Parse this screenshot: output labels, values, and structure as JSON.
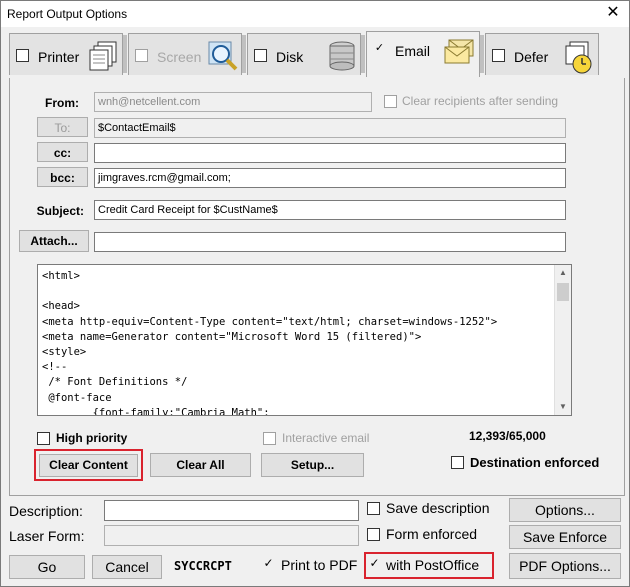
{
  "window": {
    "title": "Report Output Options",
    "close_glyph": "✕"
  },
  "tabs": [
    {
      "label": "Printer",
      "checked": false,
      "disabled": false,
      "icon": "printer-icon"
    },
    {
      "label": "Screen",
      "checked": false,
      "disabled": true,
      "icon": "magnifier-icon"
    },
    {
      "label": "Disk",
      "checked": false,
      "disabled": false,
      "icon": "disk-icon"
    },
    {
      "label": "Email",
      "checked": true,
      "disabled": false,
      "icon": "envelope-icon"
    },
    {
      "label": "Defer",
      "checked": false,
      "disabled": false,
      "icon": "clock-icon"
    }
  ],
  "email": {
    "from_label": "From:",
    "from_value": "wnh@netcellent.com",
    "clear_recipients_label": "Clear recipients after sending",
    "to_button": "To:",
    "to_value": "$ContactEmail$",
    "cc_button": "cc:",
    "cc_value": "",
    "bcc_button": "bcc:",
    "bcc_value": "jimgraves.rcm@gmail.com;",
    "subject_label": "Subject:",
    "subject_value": "Credit Card Receipt for $CustName$",
    "attach_button": "Attach...",
    "attach_value": "",
    "body": "<html>\n\n<head>\n<meta http-equiv=Content-Type content=\"text/html; charset=windows-1252\">\n<meta name=Generator content=\"Microsoft Word 15 (filtered)\">\n<style>\n<!--\n /* Font Definitions */\n @font-face\n        {font-family:\"Cambria Math\";",
    "high_priority_label": "High priority",
    "interactive_email_label": "Interactive email",
    "char_count": "12,393/65,000",
    "clear_content_button": "Clear Content",
    "clear_all_button": "Clear All",
    "setup_button": "Setup...",
    "destination_enforced_label": "Destination enforced"
  },
  "footer": {
    "description_label": "Description:",
    "description_value": "",
    "save_description_label": "Save description",
    "options_button": "Options...",
    "laser_form_label": "Laser Form:",
    "laser_form_value": "",
    "form_enforced_label": "Form enforced",
    "save_enforce_button": "Save Enforce",
    "go_button": "Go",
    "cancel_button": "Cancel",
    "report_code": "SYCCRCPT",
    "print_to_pdf_label": "Print to PDF",
    "with_postoffice_label": "with PostOffice",
    "pdf_options_button": "PDF Options..."
  }
}
